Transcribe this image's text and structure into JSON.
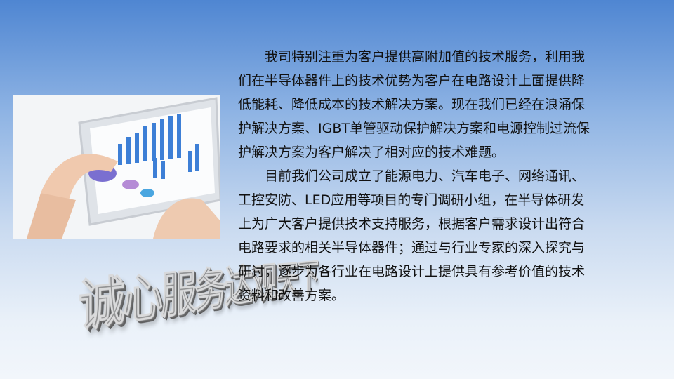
{
  "slogan": "诚心服务达观天下",
  "paragraphs": [
    {
      "lines": [
        "　　我司特别注重为客户提供高附加值的技术服务，利用我",
        "们在半导体器件上的技术优势为客户在电路设计上面提供降",
        "低能耗、降低成本的技术解决方案。现在我们已经在浪涌保",
        "护解决方案、IGBT单管驱动保护解决方案和电源控制过流保",
        "护解决方案为客户解决了相对应的技术难题。"
      ]
    },
    {
      "lines": [
        "　　目前我们公司成立了能源电力、汽车电子、网络通讯、",
        "工控安防、LED应用等项目的专门调研小组，在半导体研发",
        "上为广大客户提供技术支持服务，根据客户需求设计出符合",
        "电路要求的相关半导体器件；通过与行业专家的深入探究与",
        "研讨，逐步为各行业在电路设计上提供具有参考价值的技术",
        "资料和改善方案。"
      ]
    }
  ]
}
